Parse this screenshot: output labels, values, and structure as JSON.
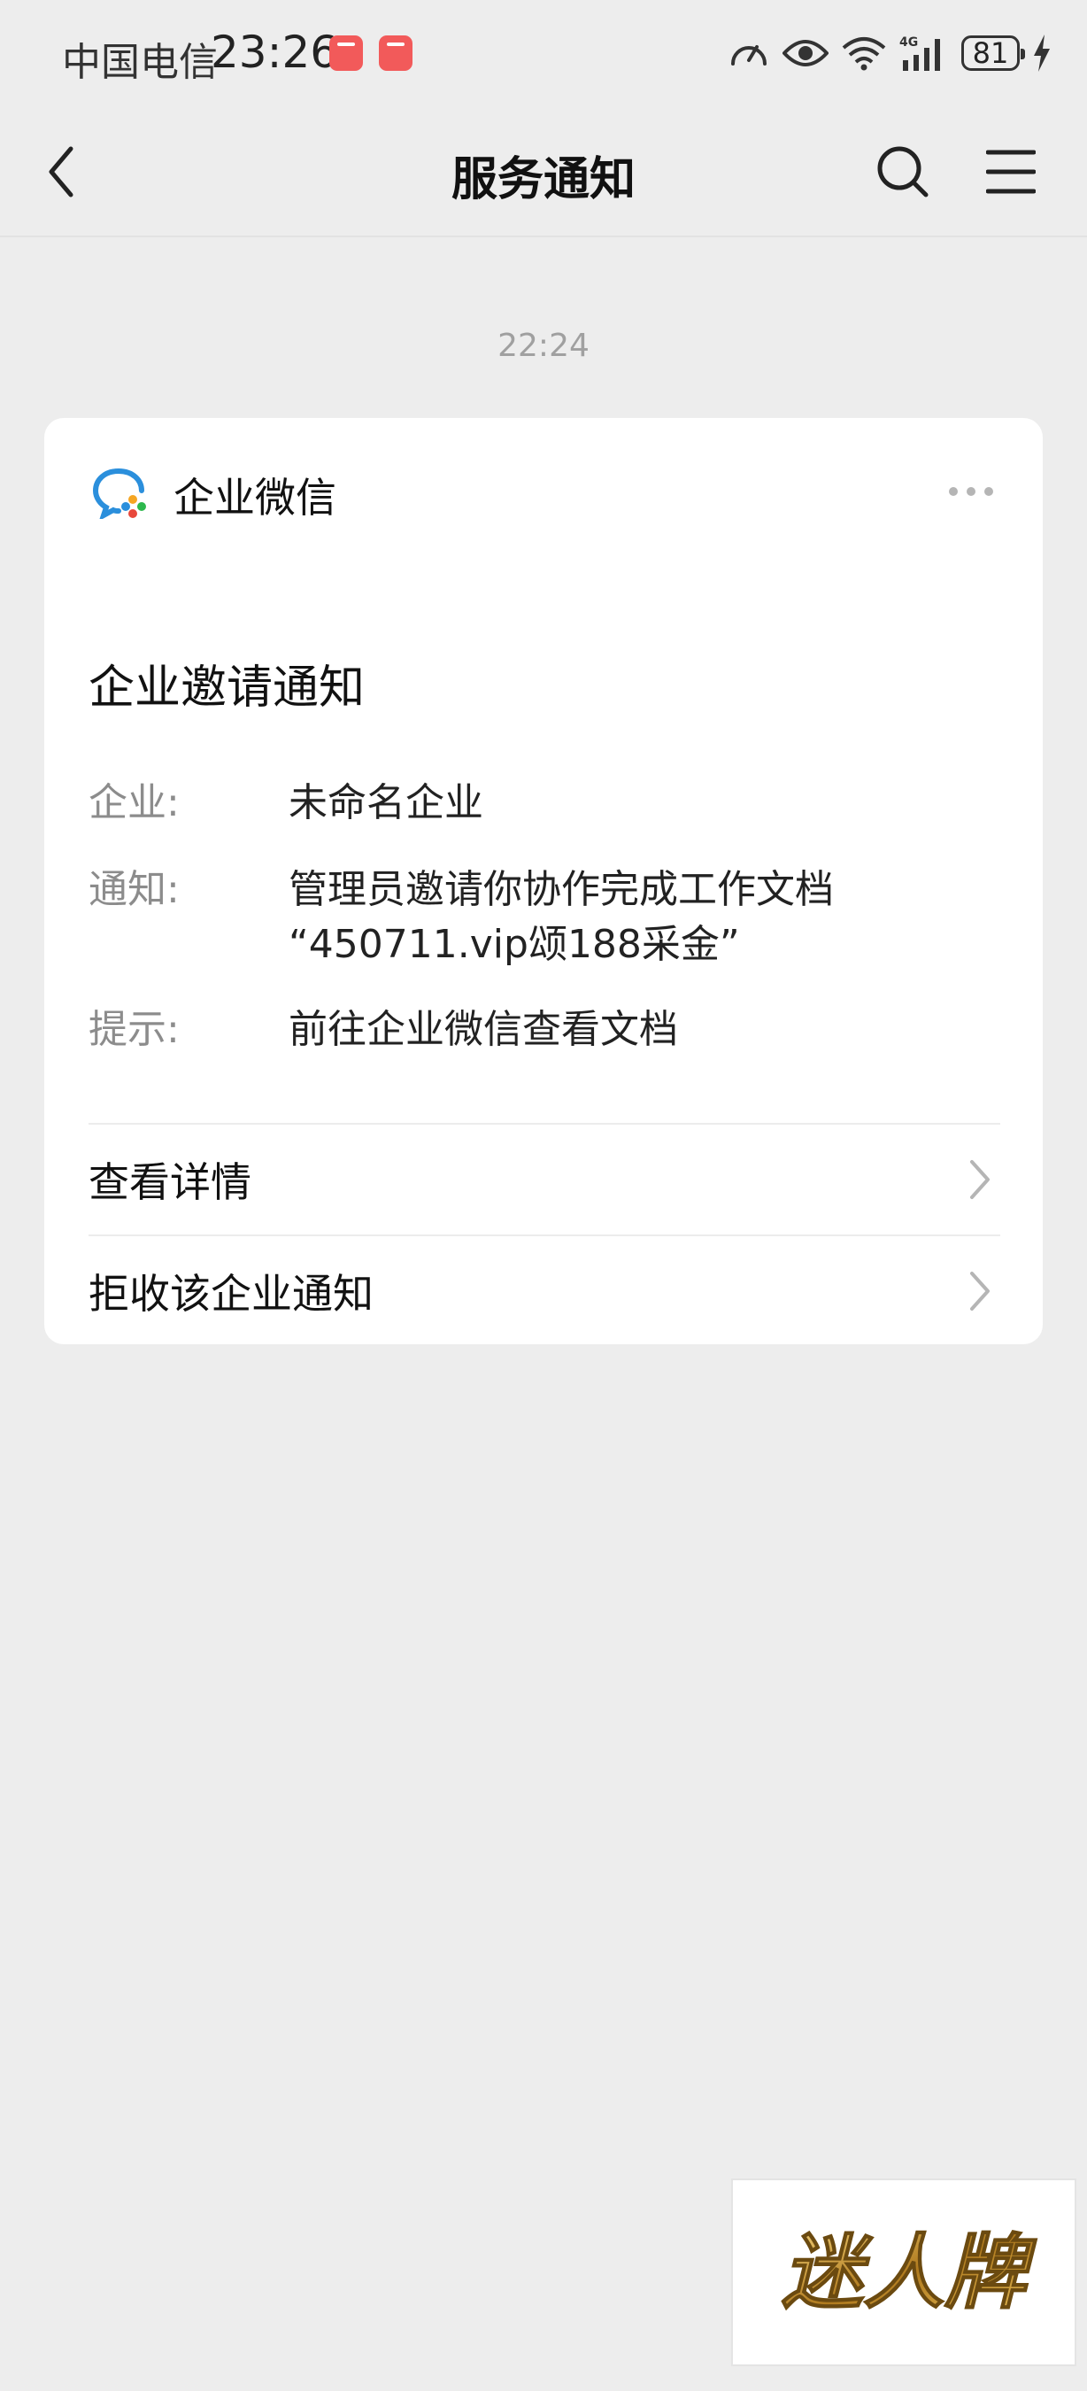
{
  "status_bar": {
    "carrier": "中国电信",
    "time": "23:26",
    "battery": "81",
    "icons": [
      "huawei-app-icon",
      "huawei-app-icon",
      "speed-icon",
      "eye-icon",
      "wifi-icon",
      "4g-signal-icon",
      "battery-icon",
      "charging-icon"
    ]
  },
  "nav": {
    "title": "服务通知",
    "back_icon": "chevron-left-icon",
    "search_icon": "search-icon",
    "menu_icon": "menu-icon"
  },
  "message_time": "22:24",
  "card": {
    "app_name": "企业微信",
    "title": "企业邀请通知",
    "fields": [
      {
        "label": "企业:",
        "value": "未命名企业"
      },
      {
        "label": "通知:",
        "value_line1": "管理员邀请你协作完成工作文档",
        "value_line2": "“450711.vip颂188采金”"
      },
      {
        "label": "提示:",
        "value": "前往企业微信查看文档"
      }
    ],
    "actions": [
      {
        "label": "查看详情"
      },
      {
        "label": "拒收该企业通知"
      }
    ]
  },
  "watermark": {
    "text": "迷人牌"
  },
  "colors": {
    "background": "#ededed",
    "card": "#ffffff",
    "label_gray": "#8c8c8c",
    "logo_blue": "#2b8fdc"
  }
}
